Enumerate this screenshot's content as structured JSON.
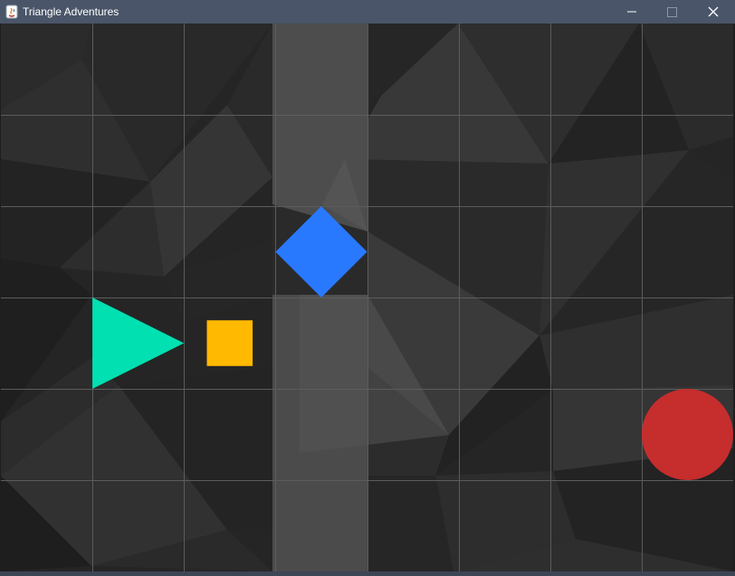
{
  "window": {
    "title": "Triangle Adventures",
    "controls": [
      "minimize",
      "maximize",
      "close"
    ],
    "titlebar_color": "#4a5569"
  },
  "board": {
    "columns": 8,
    "rows": 6,
    "background": "dark low-poly",
    "highlighted_column": 3,
    "pieces": [
      {
        "name": "player-triangle",
        "shape": "triangle",
        "direction": "right",
        "col": 1,
        "row": 3,
        "color": "#00e0b0"
      },
      {
        "name": "coin-square",
        "shape": "square",
        "col": 2,
        "row": 3,
        "color": "#ffb900"
      },
      {
        "name": "blue-diamond",
        "shape": "diamond",
        "col": 3,
        "row": 2,
        "color": "#2979ff"
      },
      {
        "name": "red-circle",
        "shape": "circle",
        "col": 7,
        "row": 4,
        "color": "#c62d2d"
      }
    ]
  }
}
